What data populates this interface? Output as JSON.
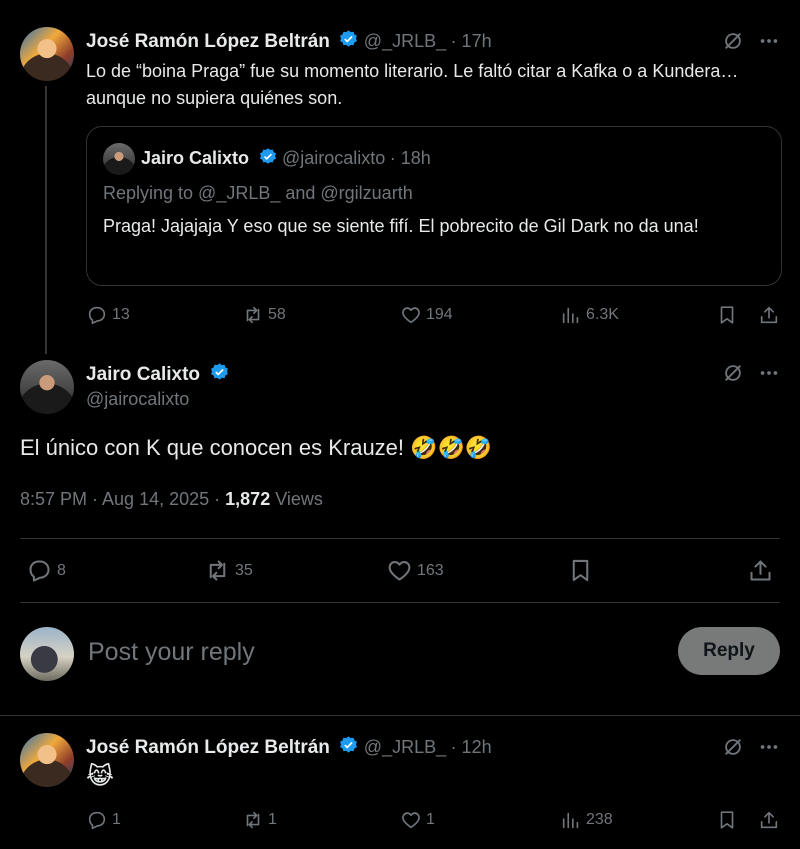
{
  "tweet1": {
    "name": "José Ramón López Beltrán",
    "handle": "@_JRLB_",
    "time": "· 17h",
    "text": "Lo de “boina Praga” fue su momento literario. Le faltó citar a Kafka o a Kundera… aunque no supiera quiénes son.",
    "quote": {
      "name": "Jairo Calixto",
      "handle": "@jairocalixto",
      "time": "· 18h",
      "replying": "Replying to @_JRLB_ and @rgilzuarth",
      "text": "Praga! Jajajaja Y eso que se siente fifí. El pobrecito de Gil Dark no da una!"
    },
    "stats": {
      "replies": "13",
      "reposts": "58",
      "likes": "194",
      "views": "6.3K"
    }
  },
  "main_tweet": {
    "name": "Jairo Calixto",
    "handle": "@jairocalixto",
    "text": "El único con K que conocen es Krauze! 🤣🤣🤣",
    "time": "8:57 PM · Aug 14, 2025 ·",
    "views_count": "1,872",
    "views_label": "Views",
    "stats": {
      "replies": "8",
      "reposts": "35",
      "likes": "163"
    }
  },
  "reply_box": {
    "placeholder": "Post your reply",
    "button": "Reply"
  },
  "tweet3": {
    "name": "José Ramón López Beltrán",
    "handle": "@_JRLB_",
    "time": "· 12h",
    "text": "😹",
    "stats": {
      "replies": "1",
      "reposts": "1",
      "likes": "1",
      "views": "238"
    }
  },
  "colors": {
    "background": "#000000",
    "text": "#e7e9ea",
    "muted": "#71767b",
    "verified": "#1d9bf0",
    "border": "#2f3336"
  },
  "icons": [
    "verified-badge-icon",
    "grok-icon",
    "more-icon",
    "reply-icon",
    "repost-icon",
    "like-icon",
    "views-icon",
    "bookmark-icon",
    "share-icon"
  ]
}
